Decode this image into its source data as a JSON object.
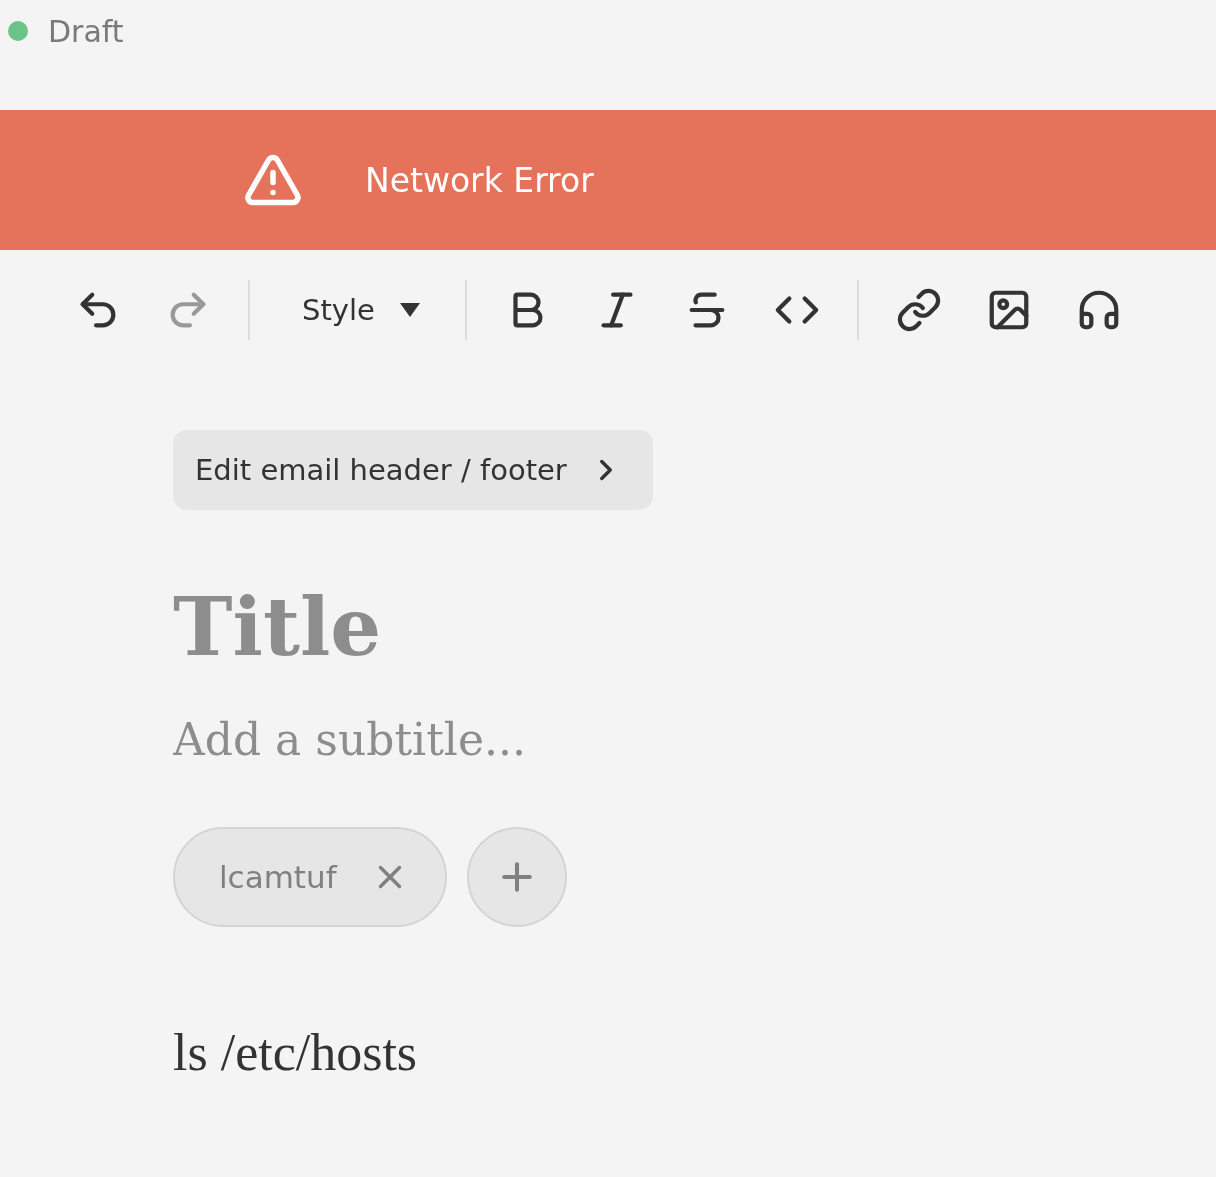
{
  "status": {
    "label": "Draft",
    "color": "#6cc287"
  },
  "banner": {
    "kind": "error",
    "message": "Network Error"
  },
  "toolbar": [
    [
      {
        "kind": "undo",
        "disabled": false
      },
      {
        "kind": "redo",
        "disabled": true
      }
    ],
    [
      {
        "kind": "style",
        "label": "Style",
        "disabled": false
      }
    ],
    [
      {
        "kind": "bold",
        "disabled": false
      },
      {
        "kind": "italic",
        "disabled": false
      },
      {
        "kind": "strike",
        "disabled": false
      },
      {
        "kind": "code",
        "disabled": false
      }
    ],
    [
      {
        "kind": "link",
        "disabled": false
      },
      {
        "kind": "image",
        "disabled": false
      },
      {
        "kind": "audio",
        "disabled": false
      }
    ]
  ],
  "header_button": {
    "label": "Edit email header / footer"
  },
  "title": {
    "placeholder": "Title"
  },
  "subtitle": {
    "placeholder": "Add a subtitle..."
  },
  "tags": [
    {
      "label": "lcamtuf"
    }
  ],
  "body": "ls /etc/hosts"
}
